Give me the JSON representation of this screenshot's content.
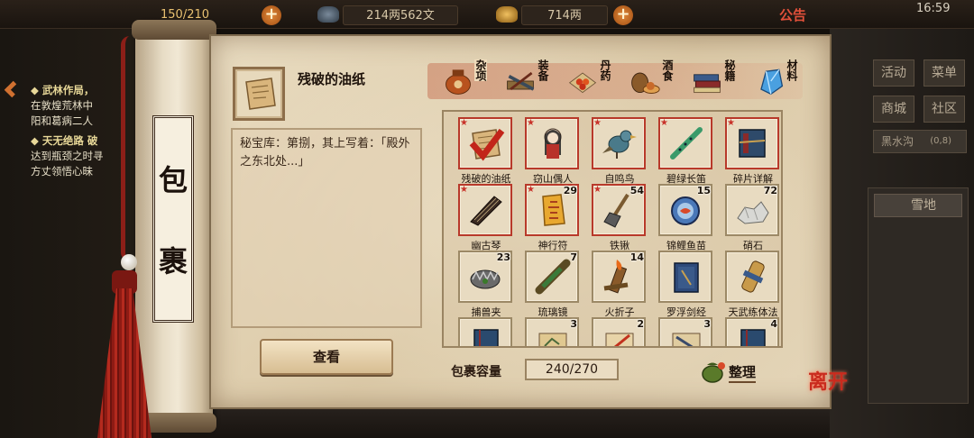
{
  "top_bar": {
    "stamina": "150/210",
    "money": "214两562文",
    "gold": "714两",
    "notice": "公告",
    "clock": "16:59"
  },
  "left_quests": [
    {
      "title": "◆ 武林作局，",
      "lines": [
        "在敦煌荒林中",
        "阳和葛病二人"
      ]
    },
    {
      "title": "◆ 天无绝路 破",
      "lines": [
        "达到瓶颈之时寻",
        "方丈领悟心昧"
      ]
    }
  ],
  "right_panel": {
    "buttons": [
      "活动",
      "菜单",
      "商城",
      "社区"
    ],
    "location": "黑水沟",
    "coords": "(0,8)",
    "terrain": "雪地"
  },
  "scroll": {
    "label_chars": [
      "包",
      "裹"
    ]
  },
  "selected": {
    "name": "残破的油纸",
    "description": "秘宝库：第捌，其上写着：「殿外之东北处...」",
    "view_button": "查看"
  },
  "tabs": [
    {
      "label": "杂项",
      "icon": "jar-icon",
      "active": true
    },
    {
      "label": "装备",
      "icon": "weapon-rack-icon",
      "active": false
    },
    {
      "label": "丹药",
      "icon": "pills-icon",
      "active": false
    },
    {
      "label": "酒食",
      "icon": "wine-food-icon",
      "active": false
    },
    {
      "label": "秘籍",
      "icon": "books-icon",
      "active": false
    },
    {
      "label": "材料",
      "icon": "crystal-icon",
      "active": false
    }
  ],
  "items": [
    {
      "name": "残破的油纸",
      "qty": "",
      "icon": "scroll-paper-icon",
      "red": true,
      "star": true,
      "checked": true
    },
    {
      "name": "窃山偶人",
      "qty": "",
      "icon": "doll-icon",
      "red": true,
      "star": true
    },
    {
      "name": "自鸣鸟",
      "qty": "",
      "icon": "mech-bird-icon",
      "red": true,
      "star": true
    },
    {
      "name": "碧绿长笛",
      "qty": "",
      "icon": "flute-icon",
      "red": true,
      "star": true
    },
    {
      "name": "碎片详解",
      "qty": "",
      "icon": "tome-icon",
      "red": true,
      "star": true
    },
    {
      "name": "幽古琴",
      "qty": "",
      "icon": "zither-icon",
      "red": true,
      "star": true
    },
    {
      "name": "神行符",
      "qty": "29",
      "icon": "talisman-icon",
      "red": true,
      "star": true
    },
    {
      "name": "铁锹",
      "qty": "54",
      "icon": "shovel-icon",
      "red": true,
      "star": true
    },
    {
      "name": "锦鲤鱼苗",
      "qty": "15",
      "icon": "fish-bowl-icon",
      "red": false,
      "star": false
    },
    {
      "name": "硝石",
      "qty": "72",
      "icon": "saltpeter-icon",
      "red": false,
      "star": false
    },
    {
      "name": "捕兽夹",
      "qty": "23",
      "icon": "trap-icon",
      "red": false,
      "star": false
    },
    {
      "name": "琉璃镜",
      "qty": "7",
      "icon": "spyglass-icon",
      "red": false,
      "star": false
    },
    {
      "name": "火折子",
      "qty": "14",
      "icon": "fire-starter-icon",
      "red": false,
      "star": false
    },
    {
      "name": "罗浮剑经",
      "qty": "",
      "icon": "manual-icon",
      "red": false,
      "star": false
    },
    {
      "name": "天武练体法",
      "qty": "",
      "icon": "scroll-case-icon",
      "red": false,
      "star": false
    },
    {
      "name": "",
      "qty": "",
      "icon": "blue-book-icon",
      "red": false,
      "star": false
    },
    {
      "name": "",
      "qty": "3",
      "icon": "map-scroll-icon",
      "red": false,
      "star": false
    },
    {
      "name": "",
      "qty": "2",
      "icon": "red-scroll-icon",
      "red": false,
      "star": false
    },
    {
      "name": "",
      "qty": "3",
      "icon": "sword-scroll-icon",
      "red": false,
      "star": false
    },
    {
      "name": "",
      "qty": "4",
      "icon": "blue-book-icon",
      "red": false,
      "star": false
    }
  ],
  "capacity": {
    "label": "包裹容量",
    "value": "240/270"
  },
  "tidy_label": "整理",
  "leave_label": "离开",
  "colors": {
    "accent_red": "#b8392a",
    "parchment": "#e3d3b4",
    "frame": "#9c8966"
  }
}
